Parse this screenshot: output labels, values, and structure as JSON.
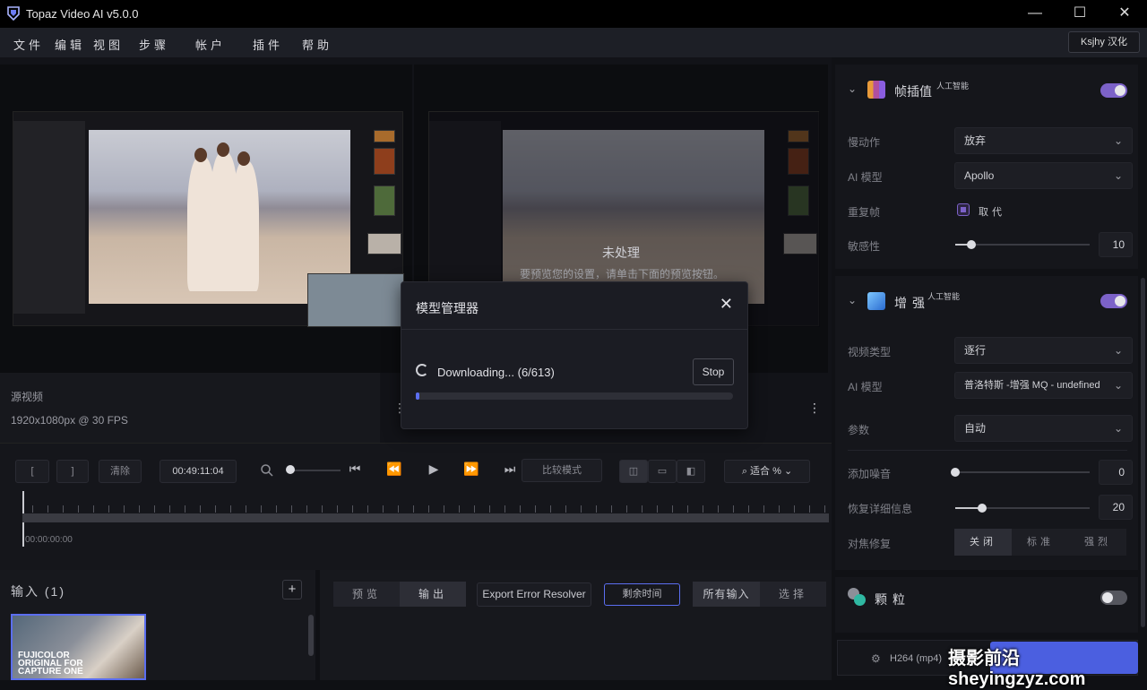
{
  "app": {
    "title": "Topaz Video AI  v5.0.0"
  },
  "window": {
    "minimize": "—",
    "maximize": "☐",
    "close": "✕"
  },
  "menu": [
    "文件",
    "编辑",
    "视图",
    "步骤",
    "帐户",
    "插件",
    "帮助"
  ],
  "translator_badge": "Ksjhy 汉化",
  "preview": {
    "right_overlay_title": "未处理",
    "right_overlay_hint": "要预览您的设置，请单击下面的预览按钮。",
    "source_label": "源视频",
    "source_meta": "1920x1080px @ 30 FPS",
    "menu_dots": "⋮"
  },
  "controls": {
    "in_mark": "[",
    "out_mark": "]",
    "clear": "清除",
    "timecode": "00:49:11:04",
    "compare_mode": "比较模式",
    "zoom_label": "适合 %",
    "timeline_start": "00:00:00:00"
  },
  "inputs": {
    "title": "输入 (1)",
    "add": "+",
    "thumb_text_1": "FUJICOLOR",
    "thumb_text_2": "ORIGINAL FOR",
    "thumb_text_3": "CAPTURE ONE"
  },
  "bottom_bar": {
    "tabs": [
      "预览",
      "输出"
    ],
    "export_error": "Export Error Resolver",
    "remaining": "剩余时间",
    "all_inputs": "所有输入",
    "select": "选择"
  },
  "panel": {
    "frame_interp": {
      "title": "帧插值",
      "badge": "人工智能",
      "enabled": true,
      "rows": [
        {
          "label": "慢动作",
          "value": "放弃"
        },
        {
          "label": "AI 模型",
          "value": "Apollo"
        }
      ],
      "dup_label": "重复帧",
      "dup_value": "取代",
      "sens_label": "敏感性",
      "sens_value": "10",
      "sens_level": 0.12
    },
    "enhance": {
      "title": "增强",
      "badge": "人工智能",
      "enabled": true,
      "rows": [
        {
          "label": "视频类型",
          "value": "逐行"
        },
        {
          "label": "AI 模型",
          "value": "普洛特斯 -增强 MQ - undefined"
        },
        {
          "label": "参数",
          "value": "自动"
        }
      ],
      "noise_label": "添加噪音",
      "noise_value": "0",
      "noise_level": 0.0,
      "detail_label": "恢复详细信息",
      "detail_value": "20",
      "detail_level": 0.2,
      "focus_label": "对焦修复",
      "focus_options": [
        "关闭",
        "标准",
        "强烈"
      ],
      "focus_selected": "关闭"
    },
    "grain": {
      "title": "颗粒",
      "enabled": false
    },
    "export_format": "H264 (mp4)"
  },
  "dialog": {
    "title": "模型管理器",
    "close": "✕",
    "status": "Downloading... (6/613)",
    "stop": "Stop",
    "progress": 0.0098
  },
  "watermark": "摄影前沿 sheyingzyz.com",
  "colors": {
    "accent": "#7c62c8",
    "progress": "#5b6ef0"
  }
}
